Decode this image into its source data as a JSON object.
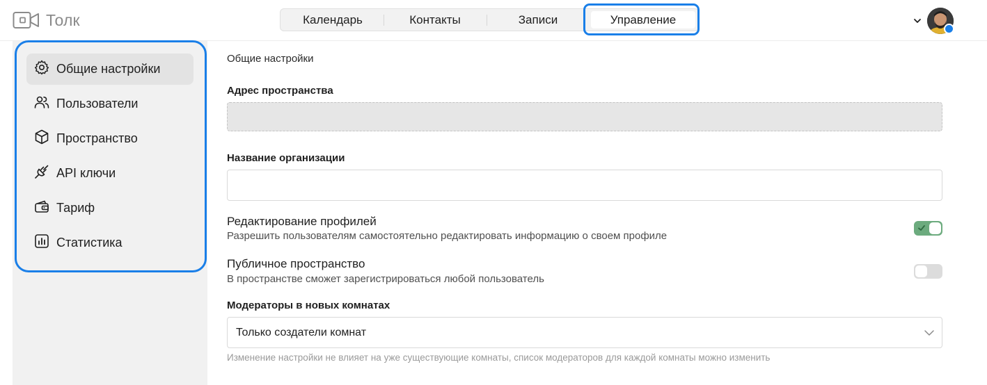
{
  "header": {
    "app_name": "Толк",
    "logo_icon": "camera-icon",
    "tabs": [
      {
        "label": "Календарь",
        "active": false
      },
      {
        "label": "Контакты",
        "active": false
      },
      {
        "label": "Записи",
        "active": false
      },
      {
        "label": "Управление",
        "active": true
      }
    ],
    "user_menu_icon": "chevron-down-icon",
    "status_color": "#1a7fe8"
  },
  "sidebar": {
    "items": [
      {
        "label": "Общие настройки",
        "icon": "gear-icon",
        "active": true
      },
      {
        "label": "Пользователи",
        "icon": "users-icon",
        "active": false
      },
      {
        "label": "Пространство",
        "icon": "cube-icon",
        "active": false
      },
      {
        "label": "API ключи",
        "icon": "plug-icon",
        "active": false
      },
      {
        "label": "Тариф",
        "icon": "wallet-icon",
        "active": false
      },
      {
        "label": "Статистика",
        "icon": "chart-icon",
        "active": false
      }
    ]
  },
  "main": {
    "title": "Общие настройки",
    "space_address": {
      "label": "Адрес пространства",
      "value": ""
    },
    "org_name": {
      "label": "Название организации",
      "value": "",
      "placeholder": ""
    },
    "profile_editing": {
      "title": "Редактирование профилей",
      "description": "Разрешить пользователям самостоятельно редактировать информацию о своем профиле",
      "enabled": true
    },
    "public_space": {
      "title": "Публичное пространство",
      "description": "В пространстве сможет зарегистрироваться любой пользователь",
      "enabled": false
    },
    "moderators": {
      "label": "Модераторы в новых комнатах",
      "selected": "Только создатели комнат",
      "hint": "Изменение настройки не влияет на уже существующие комнаты, список модераторов для каждой комнаты можно изменить"
    }
  },
  "colors": {
    "accent": "#1a7fe8",
    "toggle_on": "#6cab7e",
    "toggle_off": "#dcdcdc",
    "sidebar_bg": "#f1f1f1"
  }
}
